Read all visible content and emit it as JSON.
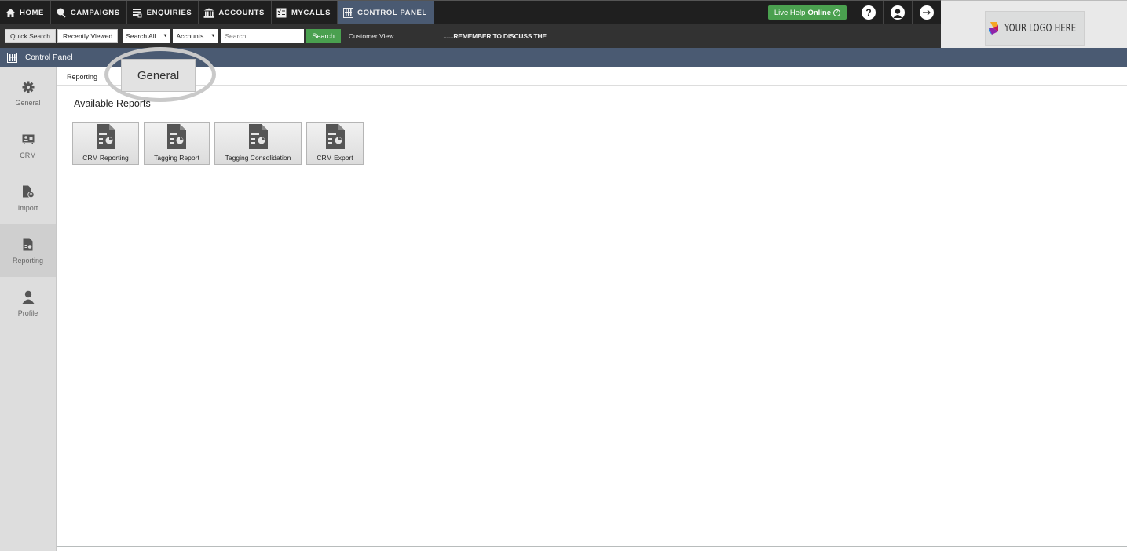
{
  "topnav": {
    "items": [
      {
        "label": "HOME",
        "icon": "home-icon"
      },
      {
        "label": "CAMPAIGNS",
        "icon": "campaigns-icon"
      },
      {
        "label": "ENQUIRIES",
        "icon": "enquiries-icon"
      },
      {
        "label": "ACCOUNTS",
        "icon": "bank-icon"
      },
      {
        "label": "MYCALLS",
        "icon": "checklist-icon"
      },
      {
        "label": "CONTROL PANEL",
        "icon": "grid-icon",
        "active": true
      }
    ],
    "live_help_label": "Live Help",
    "live_help_status": "Online",
    "help_icon": "question-icon",
    "profile_icon": "user-icon",
    "logout_icon": "arrow-right-icon"
  },
  "searchbar": {
    "quick_search": "Quick Search",
    "recently_viewed": "Recently Viewed",
    "scope_select": "Search All",
    "type_select": "Accounts",
    "search_placeholder": "Search...",
    "search_button": "Search",
    "customer_view": "Customer View",
    "ticker": "......REMEMBER TO DISCUSS THE"
  },
  "logo": {
    "text": "YOUR LOGO HERE"
  },
  "control_panel": {
    "title": "Control Panel"
  },
  "sidebar": {
    "items": [
      {
        "label": "General",
        "icon": "gear-icon"
      },
      {
        "label": "CRM",
        "icon": "crm-icon"
      },
      {
        "label": "Import",
        "icon": "import-icon"
      },
      {
        "label": "Reporting",
        "icon": "report-icon",
        "active": true
      },
      {
        "label": "Profile",
        "icon": "user-icon"
      }
    ]
  },
  "main": {
    "tabs": {
      "reporting": "Reporting",
      "general": "General"
    },
    "heading": "Available Reports",
    "reports": [
      {
        "label": "CRM Reporting"
      },
      {
        "label": "Tagging Report"
      },
      {
        "label": "Tagging Consolidation"
      },
      {
        "label": "CRM Export"
      }
    ]
  }
}
